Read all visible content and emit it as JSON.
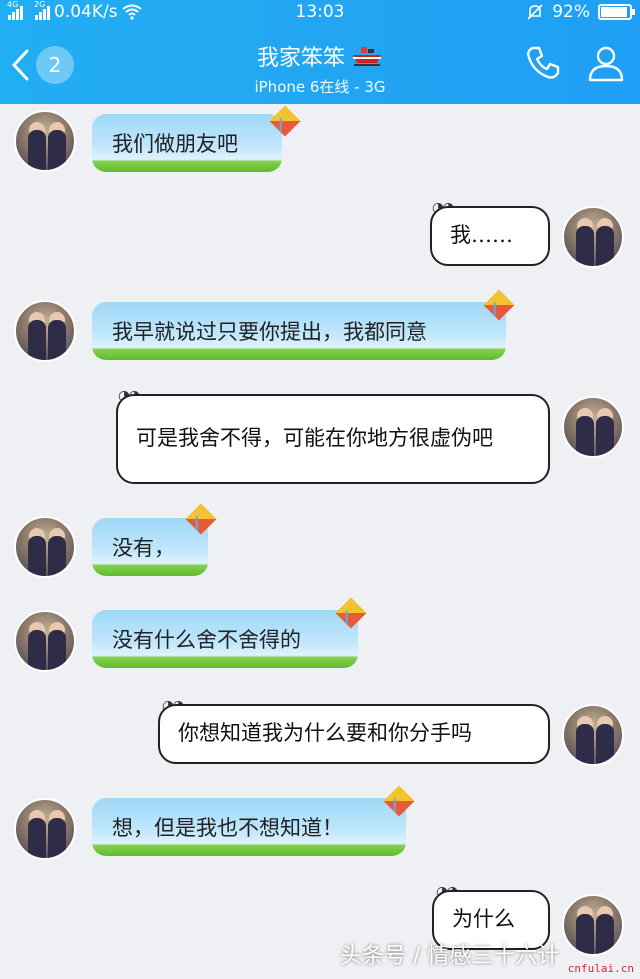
{
  "status_bar": {
    "signal1": "4G",
    "signal2": "2G",
    "speed": "0.04K/s",
    "time": "13:03",
    "battery": "92%"
  },
  "header": {
    "back_count": "2",
    "title": "我家笨笨",
    "subtitle": "iPhone 6在线 - 3G",
    "phone_icon": "phone-icon",
    "profile_icon": "profile-icon"
  },
  "messages": [
    {
      "side": "in",
      "text": "我们做朋友吧"
    },
    {
      "side": "out",
      "text": "我……"
    },
    {
      "side": "in",
      "text": "我早就说过只要你提出，我都同意"
    },
    {
      "side": "out",
      "text": "可是我舍不得，可能在你地方很虚伪吧"
    },
    {
      "side": "in",
      "text": "没有，"
    },
    {
      "side": "in",
      "text": "没有什么舍不舍得的"
    },
    {
      "side": "out",
      "text": "你想知道我为什么要和你分手吗"
    },
    {
      "side": "in",
      "text": "想，但是我也不想知道！"
    },
    {
      "side": "out",
      "text": "为什么"
    }
  ],
  "watermark": {
    "text": "头条号 / 情感三十六计",
    "site": "cnfulai.cn"
  },
  "colors": {
    "header": "#22aef3",
    "chat_bg": "#eef0f3",
    "bubble_in_top": "#9fd8f7",
    "bubble_in_grass": "#5ebb2c"
  }
}
